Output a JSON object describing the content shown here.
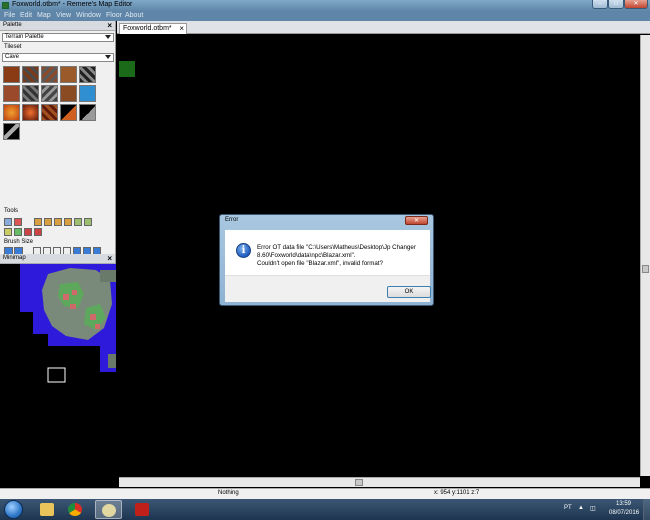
{
  "window": {
    "title": "Foxworld.otbm* - Remere's Map Editor"
  },
  "menu": [
    "File",
    "Edit",
    "Map",
    "View",
    "Window",
    "Floor",
    "About"
  ],
  "palette": {
    "panel_title": "Palette",
    "palette_select": "Terrain Palette",
    "tileset_label": "Tileset",
    "tileset_select": "Cave",
    "tools_label": "Tools",
    "brush_size_label": "Brush Size"
  },
  "minimap": {
    "panel_title": "Minimap"
  },
  "editor": {
    "tab_label": "Foxworld.otbm*"
  },
  "status": {
    "left": "Nothing",
    "coords": "x: 954 y:1101 z:7"
  },
  "dialog": {
    "title": "Error",
    "lines": [
      "Error OT data file \"C:\\Users\\Matheus\\Desktop\\Jp Changer",
      "8.60\\Foxworld\\data\\npc\\Blazar.xml\".",
      "Couldn't open file \"Blazar.xml\", invalid format?"
    ],
    "ok_label": "OK"
  },
  "taskbar": {
    "lang": "PT",
    "time": "13:59",
    "date": "08/07/2016"
  }
}
